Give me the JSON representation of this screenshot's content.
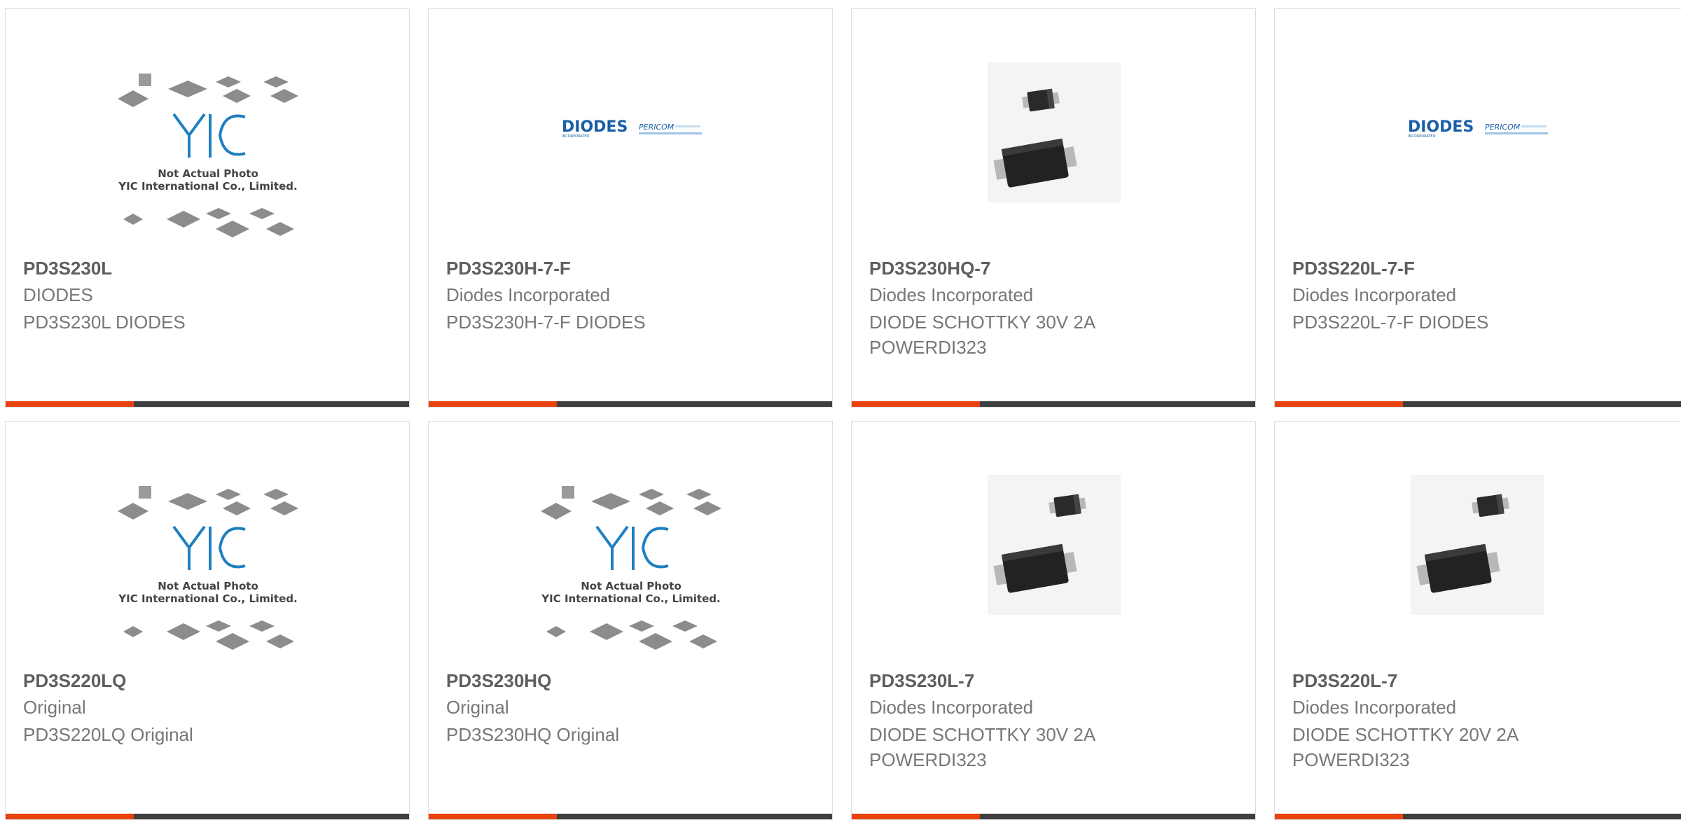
{
  "images": {
    "yic_caption_line1": "Not Actual Photo",
    "yic_caption_line2": "YIC International Co., Limited.",
    "yic_logo_text": "YIC",
    "diodes_logo_text": "DIODES",
    "diodes_logo_subtext": "INCORPORATED",
    "pericom_logo_text": "PERICOM"
  },
  "colors": {
    "accent": "#e8420f",
    "bar": "#3f3f3f",
    "part_number": "#5e5e5e",
    "meta_text": "#777777",
    "yic_blue": "#1f7fc1",
    "diodes_blue": "#1a5ea8"
  },
  "products": [
    {
      "part": "PD3S230L",
      "maker": "DIODES",
      "desc": "PD3S230L DIODES",
      "image": "yic-placeholder"
    },
    {
      "part": "PD3S230H-7-F",
      "maker": "Diodes Incorporated",
      "desc": "PD3S230H-7-F DIODES",
      "image": "diodes-logo"
    },
    {
      "part": "PD3S230HQ-7",
      "maker": "Diodes Incorporated",
      "desc": "DIODE SCHOTTKY 30V 2A POWERDI323",
      "image": "diode-package"
    },
    {
      "part": "PD3S220L-7-F",
      "maker": "Diodes Incorporated",
      "desc": "PD3S220L-7-F DIODES",
      "image": "diodes-logo"
    },
    {
      "part": "PD3S220LQ",
      "maker": "Original",
      "desc": "PD3S220LQ Original",
      "image": "yic-placeholder"
    },
    {
      "part": "PD3S230HQ",
      "maker": "Original",
      "desc": "PD3S230HQ Original",
      "image": "yic-placeholder"
    },
    {
      "part": "PD3S230L-7",
      "maker": "Diodes Incorporated",
      "desc": "DIODE SCHOTTKY 30V 2A POWERDI323",
      "image": "diode-package"
    },
    {
      "part": "PD3S220L-7",
      "maker": "Diodes Incorporated",
      "desc": "DIODE SCHOTTKY 20V 2A POWERDI323",
      "image": "diode-package"
    }
  ]
}
